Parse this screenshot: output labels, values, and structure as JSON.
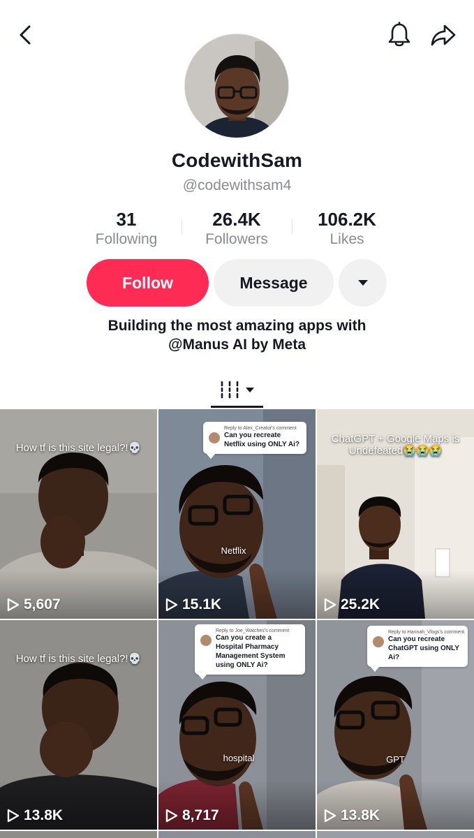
{
  "topbar": {
    "back_icon": "chevron-left-icon",
    "notification_icon": "bell-icon",
    "share_icon": "share-arrow-icon"
  },
  "profile": {
    "display_name": "CodewithSam",
    "username": "@codewithsam4"
  },
  "stats": [
    {
      "value": "31",
      "label": "Following"
    },
    {
      "value": "26.4K",
      "label": "Followers"
    },
    {
      "value": "106.2K",
      "label": "Likes"
    }
  ],
  "actions": {
    "follow_label": "Follow",
    "message_label": "Message",
    "more_icon": "caret-down-icon"
  },
  "bio": {
    "line1": "Building the most amazing apps with",
    "line2": "@Manus AI by Meta"
  },
  "tabs": {
    "videos_icon": "grid-icon",
    "dropdown_icon": "caret-down-icon"
  },
  "videos": [
    {
      "views": "5,607",
      "caption": "How tf is this site legal?!💀"
    },
    {
      "views": "15.1K",
      "reply_from": "Reply to Alex_Creator's comment",
      "reply_text": "Can you recreate Netflix using ONLY Ai?",
      "label": "Netflix"
    },
    {
      "views": "25.2K",
      "caption": "ChatGPT + Google Maps is Undefeated😭😭😭"
    },
    {
      "views": "13.8K",
      "caption": "How tf is this site legal?!💀"
    },
    {
      "views": "8,717",
      "reply_from": "Reply to Joe_Watches's comment",
      "reply_text": "Can you create a Hospital Pharmacy Management System using ONLY Ai?",
      "label": "hospital"
    },
    {
      "views": "13.8K",
      "reply_from": "Reply to Hannah_Vlogs's comment",
      "reply_text": "Can you recreate ChatGPT using ONLY Ai?",
      "label": "GPT"
    }
  ],
  "colors": {
    "accent": "#fe2c55",
    "secondary_button": "#f1f1f2",
    "muted_text": "#8a8b91",
    "primary_text": "#161823"
  }
}
